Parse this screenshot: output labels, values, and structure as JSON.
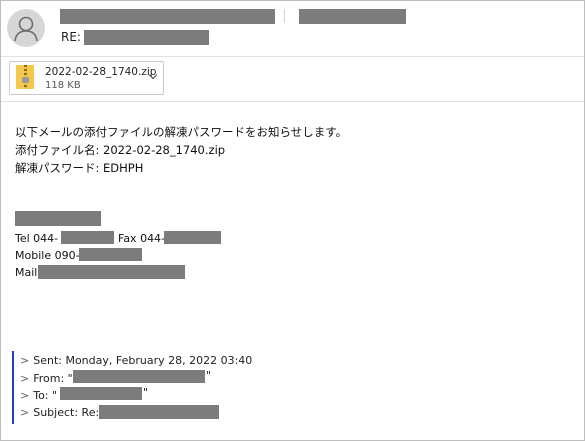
{
  "header": {
    "re_prefix": "RE:",
    "avatar_icon": "person-icon"
  },
  "attachment": {
    "file_name": "2022-02-28_1740.zip",
    "file_size": "118 KB",
    "icon": "zip-file-icon",
    "menu_icon": "chevron-down-icon"
  },
  "message": {
    "line1": "以下メールの添付ファイルの解凍パスワードをお知らせします。",
    "line2": "添付ファイル名: 2022-02-28_1740.zip",
    "line3": "解凍パスワード: EDHPH"
  },
  "signature": {
    "tel_label": "Tel 044-",
    "fax_label": "Fax 044-",
    "mobile_label": "Mobile 090-",
    "mail_label": "Mail"
  },
  "quoted": {
    "sent": "Sent: Monday, February 28, 2022 03:40",
    "from_label": "From: \"",
    "to_label": "To: \"",
    "subject_label": "Subject: Re:",
    "close_quote": "\"",
    "marker": ">"
  },
  "colors": {
    "redaction": "#7c7c7c",
    "quote_bar": "#1f3fbf"
  }
}
